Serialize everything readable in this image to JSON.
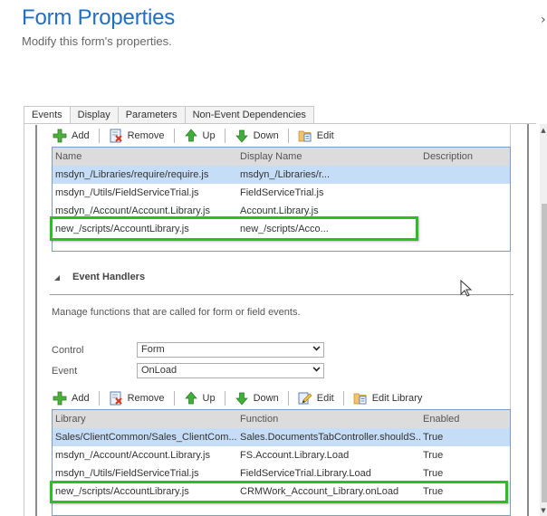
{
  "header": {
    "title": "Form Properties",
    "subtitle": "Modify this form's properties.",
    "close_icon": "close-icon"
  },
  "tabs": [
    {
      "label": "Events",
      "active": true
    },
    {
      "label": "Display",
      "active": false
    },
    {
      "label": "Parameters",
      "active": false
    },
    {
      "label": "Non-Event Dependencies",
      "active": false
    }
  ],
  "libraries": {
    "toolbar": {
      "add": "Add",
      "remove": "Remove",
      "up": "Up",
      "down": "Down",
      "edit": "Edit"
    },
    "columns": [
      "Name",
      "Display Name",
      "Description"
    ],
    "rows": [
      {
        "name": "msdyn_/Libraries/require/require.js",
        "display_name": "msdyn_/Libraries/r...",
        "description": "",
        "selected": true
      },
      {
        "name": "msdyn_/Utils/FieldServiceTrial.js",
        "display_name": "FieldServiceTrial.js",
        "description": "",
        "selected": false
      },
      {
        "name": "msdyn_/Account/Account.Library.js",
        "display_name": "Account.Library.js",
        "description": "",
        "selected": false
      },
      {
        "name": "new_/scripts/AccountLibrary.js",
        "display_name": "new_/scripts/Acco...",
        "description": "",
        "selected": false,
        "highlighted": true
      }
    ]
  },
  "event_handlers": {
    "section_title": "Event Handlers",
    "description": "Manage functions that are called for form or field events.",
    "control_label": "Control",
    "control_value": "Form",
    "event_label": "Event",
    "event_value": "OnLoad",
    "toolbar": {
      "add": "Add",
      "remove": "Remove",
      "up": "Up",
      "down": "Down",
      "edit": "Edit",
      "edit_library": "Edit Library"
    },
    "columns": [
      "Library",
      "Function",
      "Enabled"
    ],
    "rows": [
      {
        "library": "Sales/ClientCommon/Sales_ClientCom...",
        "function": "Sales.DocumentsTabController.shouldS...",
        "enabled": "True",
        "selected": true
      },
      {
        "library": "msdyn_/Account/Account.Library.js",
        "function": "FS.Account.Library.Load",
        "enabled": "True",
        "selected": false
      },
      {
        "library": "msdyn_/Utils/FieldServiceTrial.js",
        "function": "FieldServiceTrial.Library.Load",
        "enabled": "True",
        "selected": false
      },
      {
        "library": "new_/scripts/AccountLibrary.js",
        "function": "CRMWork_Account_Library.onLoad",
        "enabled": "True",
        "selected": false,
        "highlighted": true
      }
    ]
  },
  "colors": {
    "title": "#1f6fc5",
    "selected_row": "#c6ddf7",
    "header_row": "#dcdcdc",
    "highlight_box": "#2ac11f",
    "grid_border": "#7a9cc6"
  }
}
